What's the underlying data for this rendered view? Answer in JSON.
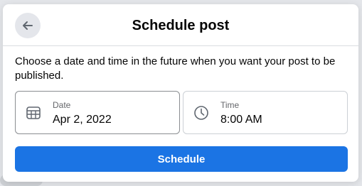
{
  "dialog": {
    "title": "Schedule post",
    "description": "Choose a date and time in the future when you want your post to be published.",
    "back_icon": "arrow-left-icon"
  },
  "date_field": {
    "label": "Date",
    "value": "Apr 2, 2022",
    "icon": "calendar-icon"
  },
  "time_field": {
    "label": "Time",
    "value": "8:00 AM",
    "icon": "clock-icon"
  },
  "actions": {
    "schedule_label": "Schedule"
  },
  "colors": {
    "primary": "#1b74e4",
    "text": "#050505",
    "secondary_text": "#65676b",
    "back_button_bg": "#e4e6eb"
  }
}
